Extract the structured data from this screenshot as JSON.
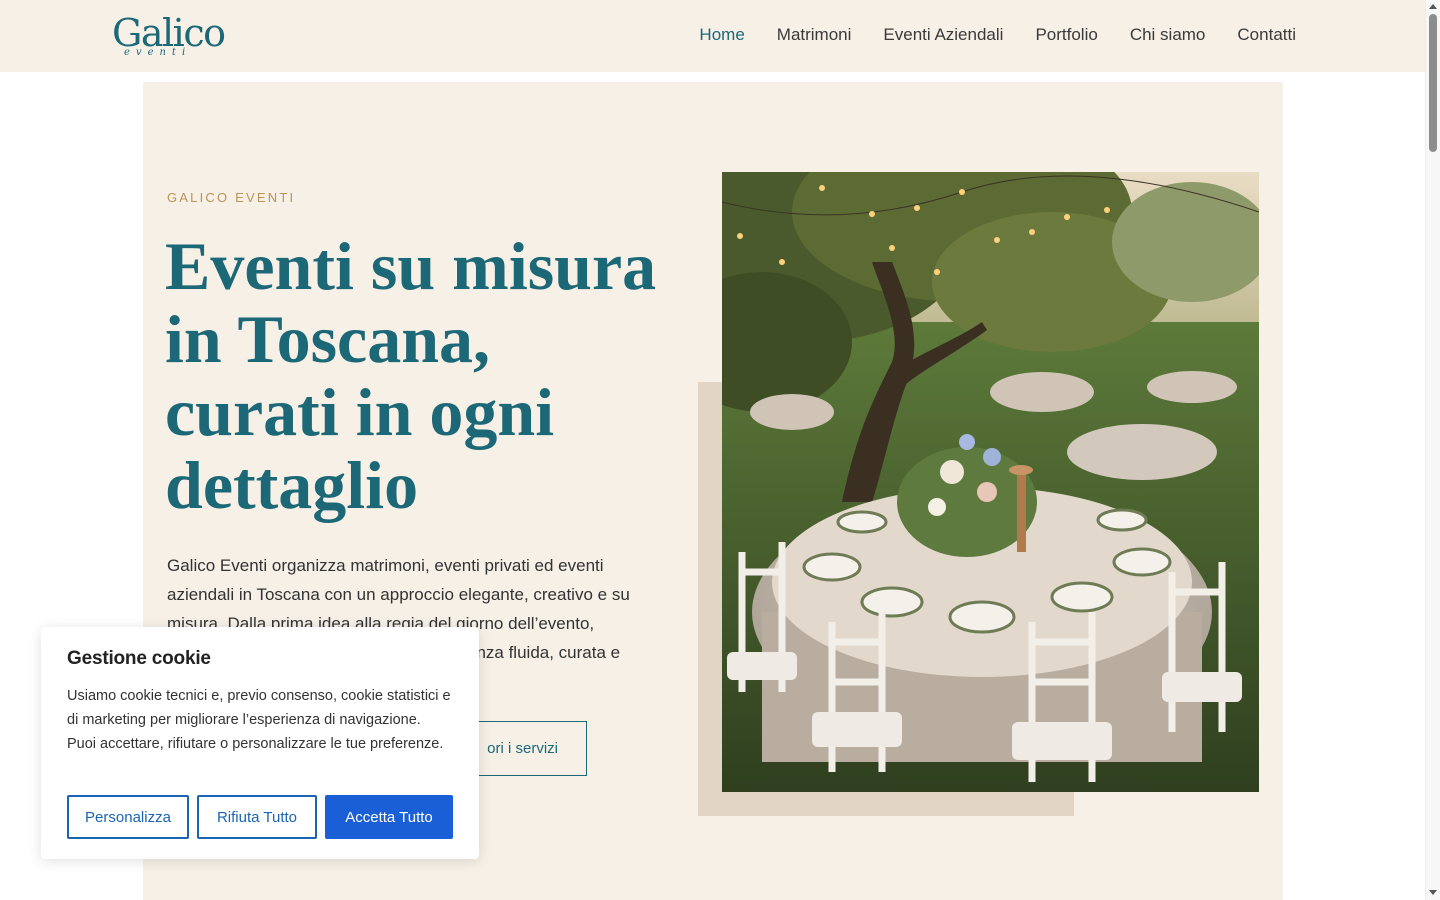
{
  "header": {
    "logo": {
      "main": "Galico",
      "sub": "eventi"
    },
    "nav": [
      "Home",
      "Matrimoni",
      "Eventi Aziendali",
      "Portfolio",
      "Chi siamo",
      "Contatti"
    ],
    "active_nav": "Home"
  },
  "hero": {
    "eyebrow": "GALICO EVENTI",
    "headline_lines": [
      "Eventi su misura",
      "in Toscana,",
      "curati in ogni",
      "dettaglio"
    ],
    "description": "Galico Eventi organizza matrimoni, eventi privati ed eventi aziendali in Toscana con un approccio elegante, creativo e su misura. Dalla prima idea alla regia del giorno dell’evento, ... enza fluida, curata e",
    "description_visible_lines": [
      "Galico Eventi organizza matrimoni, eventi privati ed eventi",
      "aziendali in Toscana con un approccio elegante, creativo e su",
      "misura. Dalla prima idea alla regia del giorno dell’evento,",
      "enza fluida, curata e"
    ],
    "secondary_button": "ori i servizi",
    "image": "wedding-table-under-olive-tree"
  },
  "cookie_banner": {
    "title": "Gestione cookie",
    "text": "Usiamo cookie tecnici e, previo consenso, cookie statistici e di marketing per migliorare l’esperienza di navigazione. Puoi accettare, rifiutare o personalizzare le tue preferenze.",
    "buttons": {
      "customize": "Personalizza",
      "reject": "Rifiuta Tutto",
      "accept": "Accetta Tutto"
    }
  },
  "colors": {
    "brand": "#1c6877",
    "cream": "#f6f0e7",
    "gold": "#bb9457",
    "accept_blue": "#1a5fd6"
  }
}
